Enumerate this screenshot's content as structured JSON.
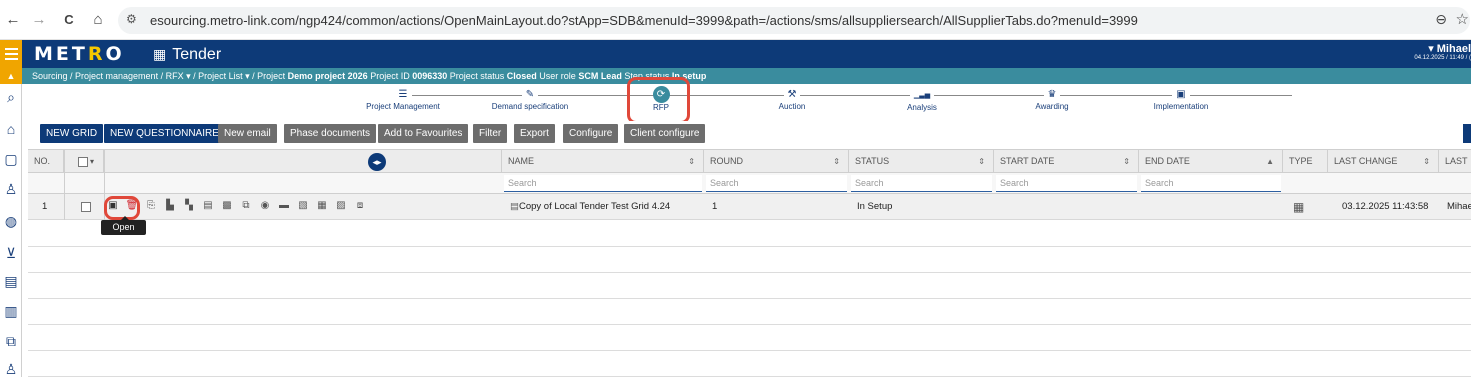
{
  "browser": {
    "url": "esourcing.metro-link.com/ngp424/common/actions/OpenMainLayout.do?stApp=SDB&menuId=3999&path=/actions/sms/allsuppliersearch/AllSupplierTabs.do?menuId=3999",
    "back_icon": "←",
    "forward_icon": "→",
    "reload_icon": "C",
    "home_icon": "⌂",
    "tune_icon": "⚙",
    "zoom_icon": "⊖",
    "star_icon": "☆"
  },
  "app": {
    "logo_part1": "MET",
    "logo_part2": "R",
    "logo_part3": "O",
    "title": "Tender",
    "title_icon": "▦",
    "user_name": "▾ Mihael",
    "user_timestamp": "04.12.2025 / 11:49 / ("
  },
  "breadcrumb": {
    "text_1": "Sourcing  /  Project management / RFX ▾  /  Project List ▾  /  Project ",
    "project_name": "Demo project 2026",
    "text_2": "  Project ID ",
    "project_id": "0096330",
    "text_3": "  Project status ",
    "project_status": "Closed",
    "text_4": "  User role ",
    "user_role": "SCM Lead",
    "text_5": "  Step status ",
    "step_status": "In setup"
  },
  "stepper": {
    "steps": [
      {
        "label": "Project Management",
        "icon": "☰"
      },
      {
        "label": "Demand specification",
        "icon": "✎"
      },
      {
        "label": "RFP",
        "icon": "⟳"
      },
      {
        "label": "Auction",
        "icon": "⚒"
      },
      {
        "label": "Analysis",
        "icon": "▁▃▅"
      },
      {
        "label": "Awarding",
        "icon": "♛"
      },
      {
        "label": "Implementation",
        "icon": "▣"
      }
    ]
  },
  "toolbar": {
    "buttons": [
      "NEW GRID",
      "NEW QUESTIONNAIRE",
      "New email",
      "Phase documents",
      "Add to Favourites",
      "Filter",
      "Export",
      "Configure",
      "Client configure"
    ]
  },
  "grid": {
    "columns": {
      "no": "NO.",
      "select": "▾",
      "name": "NAME",
      "round": "ROUND",
      "status": "STATUS",
      "start_date": "START DATE",
      "end_date": "END DATE",
      "type": "TYPE",
      "last_change": "LAST CHANGE",
      "last": "LAST"
    },
    "sort_icon": "⇕",
    "sort_active_icon": "▲",
    "expand_icon": "◂▸",
    "search_placeholder": "Search",
    "rows": [
      {
        "no": "1",
        "name": "Copy of Local Tender Test Grid 4.24",
        "name_icon": "▤",
        "round": "1",
        "status": "In Setup",
        "type_icon": "▦",
        "last_change": "03.12.2025 11:43:58",
        "last": "Mihae"
      }
    ],
    "action_icons": [
      "▣",
      "🗑",
      "⎘",
      "▙",
      "▚",
      "▤",
      "▩",
      "⧉",
      "◉",
      "▬",
      "▧",
      "▦",
      "▨",
      "⧈"
    ],
    "tooltip": "Open"
  },
  "rail": {
    "icons": [
      "⌕",
      "⌂",
      "▢",
      "♙",
      "◍",
      "⊻",
      "▤",
      "▥",
      "⧉",
      "♙"
    ]
  }
}
